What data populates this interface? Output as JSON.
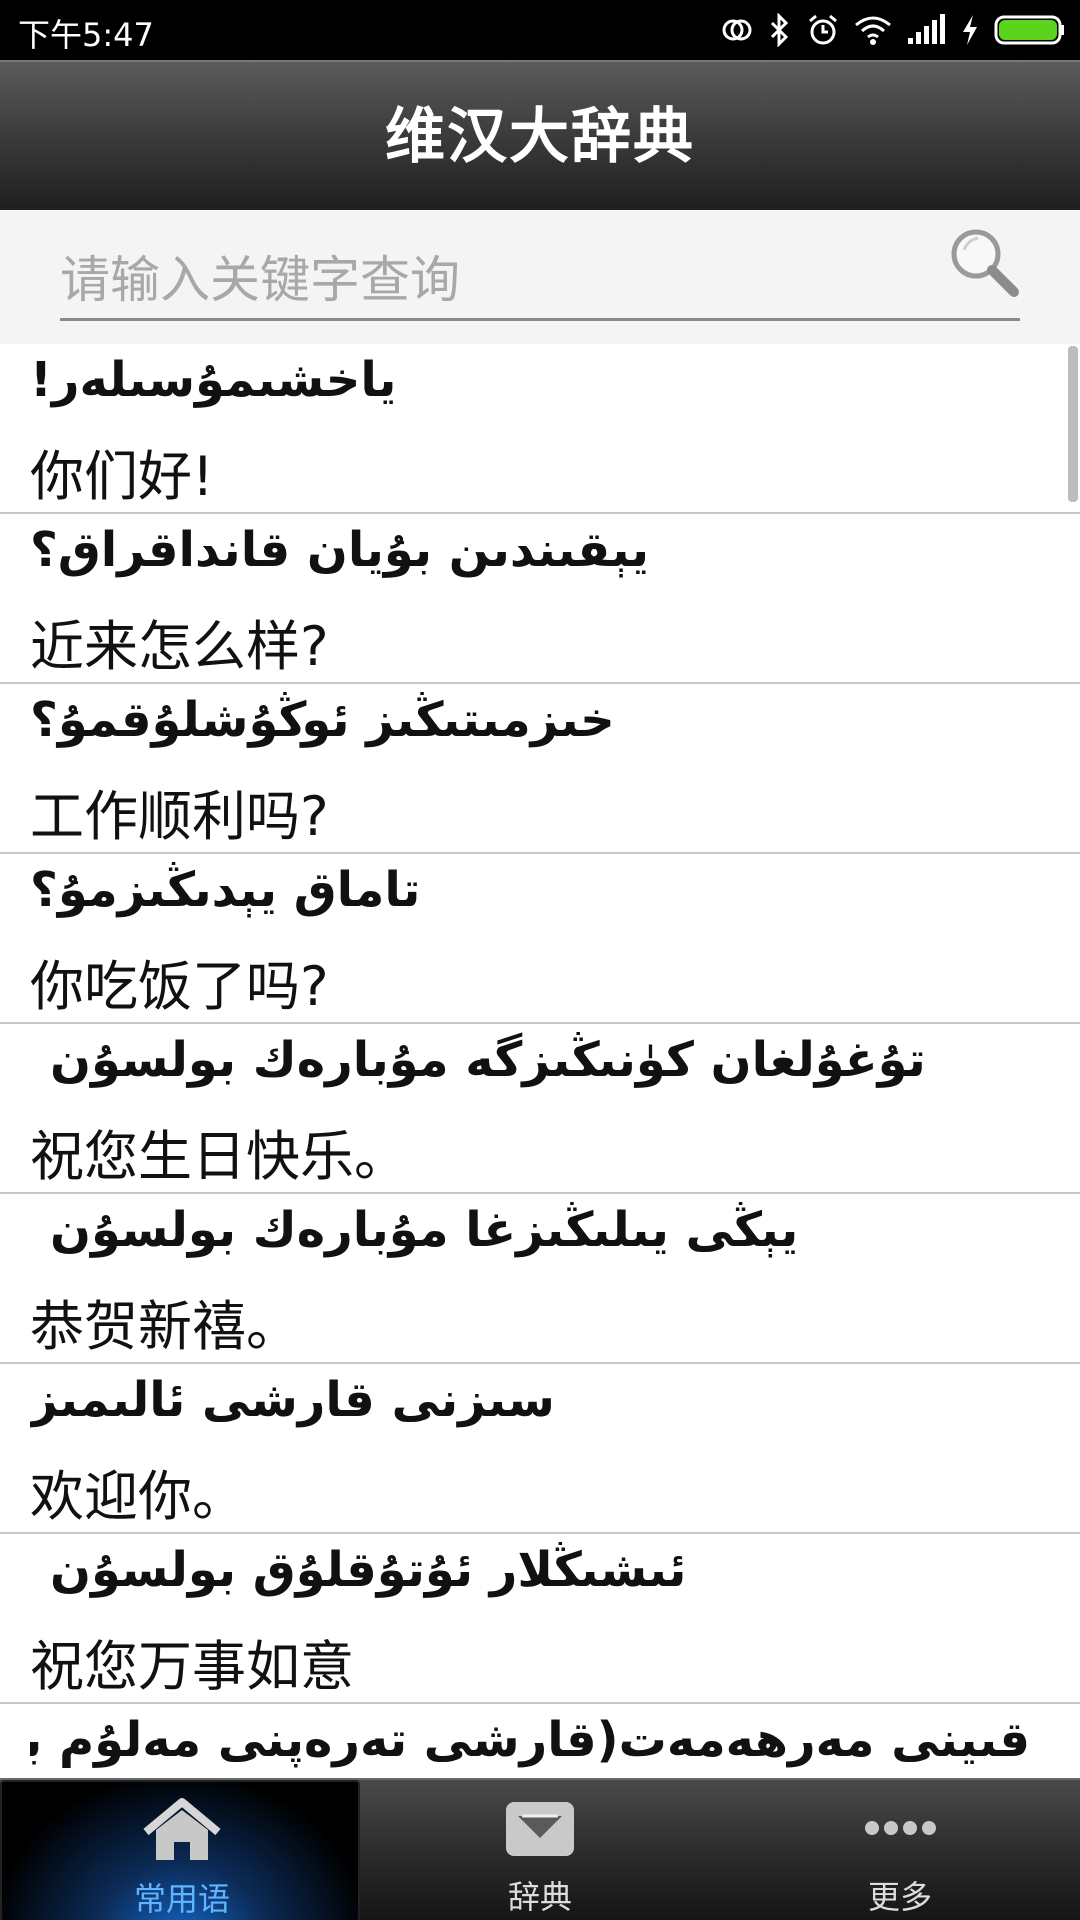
{
  "status_bar": {
    "time": "下午5:47"
  },
  "header": {
    "title": "维汉大辞典"
  },
  "search": {
    "placeholder": "请输入关键字查询"
  },
  "phrases": [
    {
      "uyghur": "ياخشىمۇسىلەر!",
      "chinese": "你们好!"
    },
    {
      "uyghur": "يېقىندىن بۇيان قانداقراق؟",
      "chinese": "近来怎么样?"
    },
    {
      "uyghur": "خىزمىتىڭىز ئوڭۇشلۇقمۇ؟",
      "chinese": "工作顺利吗?"
    },
    {
      "uyghur": "تاماق يېدىڭىزمۇ؟",
      "chinese": "你吃饭了吗?"
    },
    {
      "uyghur": "تۇغۇلغان كۈنىڭىزگە مۇبارەك بولسۇن",
      "chinese": "祝您生日快乐。"
    },
    {
      "uyghur": "يېڭى يىلىڭىزغا مۇبارەك بولسۇن",
      "chinese": "恭贺新禧。"
    },
    {
      "uyghur": "سىزنى قارشى ئالىمىز",
      "chinese": "欢迎你。"
    },
    {
      "uyghur": "ئىشىڭلار ئۇتۇقلۇق بولسۇن",
      "chinese": "祝您万事如意"
    },
    {
      "uyghur": "قىينى مەرھەمەت(قارشى تەرەپنى مەلۇم بىر ئىشقا",
      "chinese": ""
    }
  ],
  "bottom_nav": [
    {
      "label": "常用语",
      "icon": "home-icon",
      "active": true
    },
    {
      "label": "辞典",
      "icon": "inbox-icon",
      "active": false
    },
    {
      "label": "更多",
      "icon": "more-dots-icon",
      "active": false
    }
  ]
}
